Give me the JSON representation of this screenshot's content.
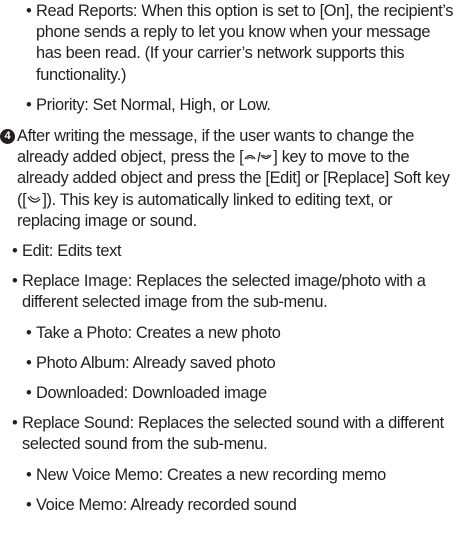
{
  "read_reports": {
    "text": "Read Reports: When this option is set to [On], the recipient’s phone sends a reply to let you know when your message has been read. (If your carrier’s network supports this functionality.)"
  },
  "priority": {
    "text": "Priority: Set Normal, High, or Low."
  },
  "step4": {
    "number": "4",
    "part1": "After writing the message, if the user wants to change the already added object, press the [",
    "part2": "] key to move to the already added object and press the [Edit] or [Replace] Soft key ([",
    "part3": "]). This key is automatically linked to editing text, or replacing image or sound."
  },
  "options": {
    "edit": "Edit: Edits text",
    "replace_image": "Replace Image: Replaces the selected image/photo with a different selected image from the sub-menu.",
    "take_photo": "Take a Photo: Creates a new photo",
    "photo_album": "Photo Album: Already saved photo",
    "downloaded": "Downloaded: Downloaded image",
    "replace_sound": "Replace Sound: Replaces the selected sound with a different selected sound from the sub-menu.",
    "new_voice_memo": "New Voice Memo: Creates a new recording memo",
    "voice_memo": "Voice Memo: Already recorded sound"
  },
  "icons": {
    "nav_key": "up-down-navigation-key-icon",
    "soft_key": "right-soft-key-icon"
  }
}
